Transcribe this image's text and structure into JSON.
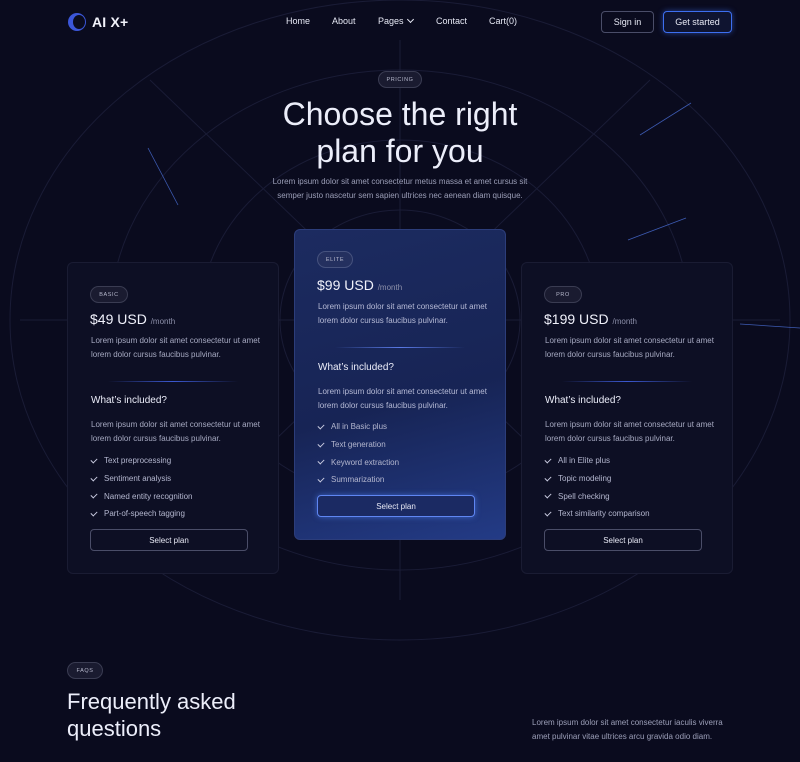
{
  "brand": {
    "name": "AI X+"
  },
  "nav": {
    "items": [
      {
        "label": "Home"
      },
      {
        "label": "About"
      },
      {
        "label": "Pages"
      },
      {
        "label": "Contact"
      },
      {
        "label": "Cart(0)"
      }
    ],
    "sign_in": "Sign in",
    "get_started": "Get started"
  },
  "hero": {
    "badge": "PRICING",
    "title_line1": "Choose the right",
    "title_line2": "plan for you",
    "subtitle": "Lorem ipsum dolor sit amet consectetur metus massa et amet cursus sit semper justo nascetur sem sapien ultrices nec aenean diam quisque."
  },
  "plans": [
    {
      "badge": "BASIC",
      "price": "$49 USD",
      "period": "/month",
      "description": "Lorem ipsum dolor sit amet consectetur ut amet lorem dolor cursus faucibus pulvinar.",
      "included_heading": "What’s included?",
      "included_description": "Lorem ipsum dolor sit amet consectetur ut amet lorem dolor cursus faucibus pulvinar.",
      "features": [
        "Text preprocessing",
        "Sentiment analysis",
        "Named entity recognition",
        "Part-of-speech tagging"
      ],
      "cta": "Select plan"
    },
    {
      "badge": "ELITE",
      "price": "$99 USD",
      "period": "/month",
      "description": "Lorem ipsum dolor sit amet consectetur ut amet lorem dolor cursus faucibus pulvinar.",
      "included_heading": "What’s included?",
      "included_description": "Lorem ipsum dolor sit amet consectetur ut amet lorem dolor cursus faucibus pulvinar.",
      "features": [
        "All in Basic plus",
        "Text generation",
        "Keyword extraction",
        "Summarization"
      ],
      "cta": "Select plan"
    },
    {
      "badge": "PRO",
      "price": "$199 USD",
      "period": "/month",
      "description": "Lorem ipsum dolor sit amet consectetur ut amet lorem dolor cursus faucibus pulvinar.",
      "included_heading": "What’s included?",
      "included_description": "Lorem ipsum dolor sit amet consectetur ut amet lorem dolor cursus faucibus pulvinar.",
      "features": [
        "All in Elite plus",
        "Topic modeling",
        "Spell checking",
        "Text similarity comparison"
      ],
      "cta": "Select plan"
    }
  ],
  "faq": {
    "badge": "FAQS",
    "title_line1": "Frequently asked",
    "title_line2": "questions",
    "subtitle": "Lorem ipsum dolor sit amet consectetur iaculis viverra amet pulvinar vitae ultrices arcu gravida odio diam."
  },
  "colors": {
    "background": "#0a0b1e",
    "accent": "#3d6ff0",
    "highlight_card": "#1c2b60"
  }
}
